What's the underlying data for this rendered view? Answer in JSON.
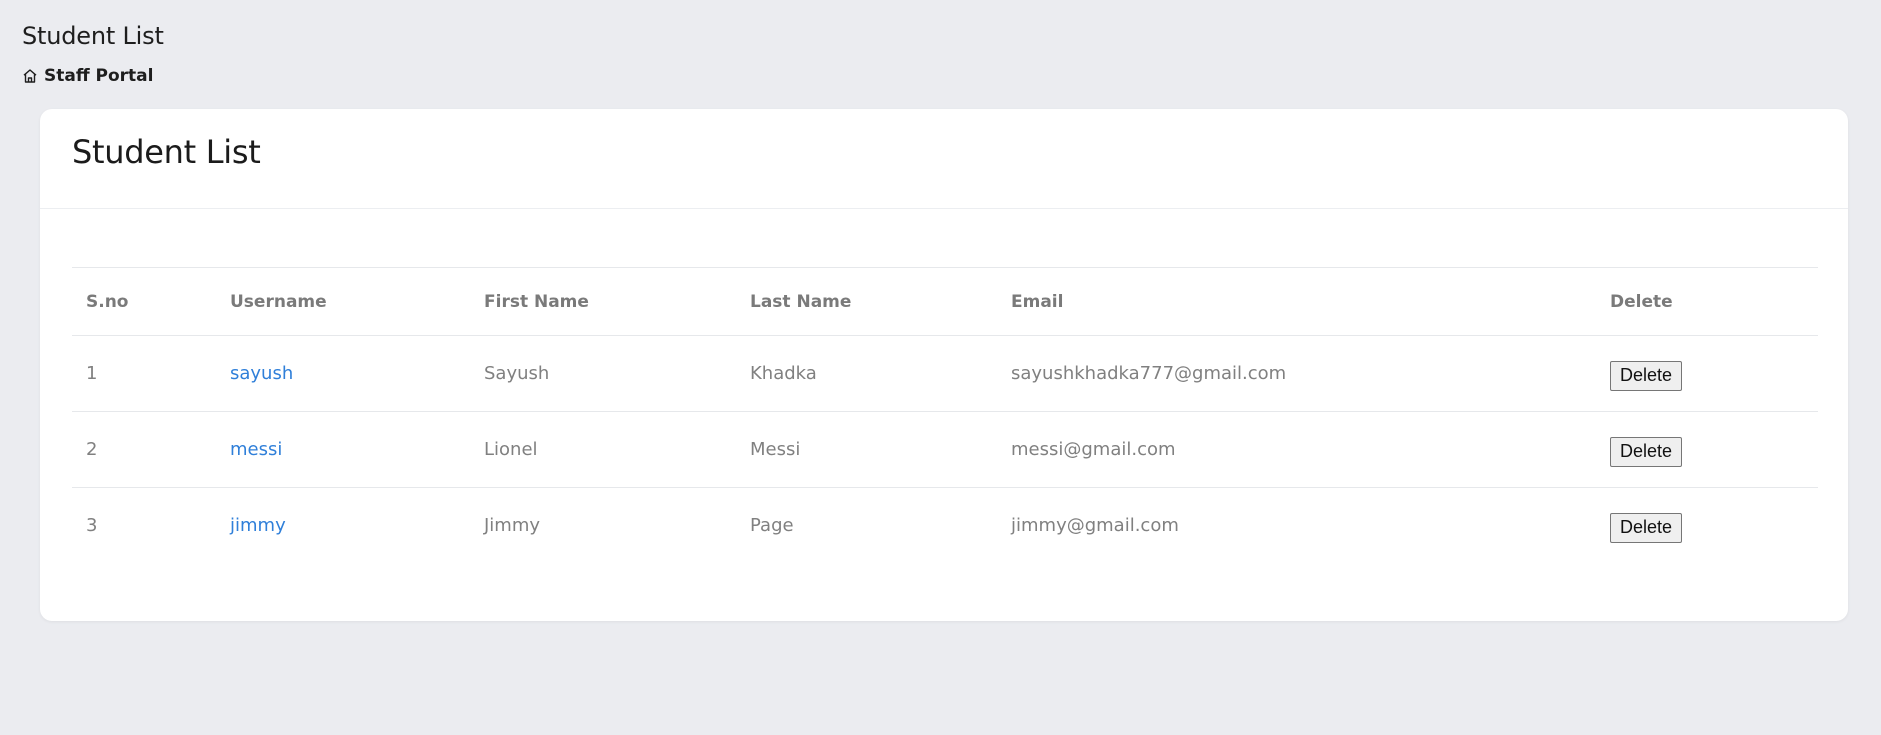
{
  "page": {
    "title": "Student List"
  },
  "breadcrumb": {
    "icon": "home-icon",
    "label": "Staff Portal"
  },
  "card": {
    "title": "Student List"
  },
  "table": {
    "headers": [
      "S.no",
      "Username",
      "First Name",
      "Last Name",
      "Email",
      "Delete"
    ],
    "rows": [
      {
        "sno": "1",
        "username": "sayush",
        "first_name": "Sayush",
        "last_name": "Khadka",
        "email": "sayushkhadka777@gmail.com",
        "delete_label": "Delete"
      },
      {
        "sno": "2",
        "username": "messi",
        "first_name": "Lionel",
        "last_name": "Messi",
        "email": "messi@gmail.com",
        "delete_label": "Delete"
      },
      {
        "sno": "3",
        "username": "jimmy",
        "first_name": "Jimmy",
        "last_name": "Page",
        "email": "jimmy@gmail.com",
        "delete_label": "Delete"
      }
    ]
  },
  "colors": {
    "background": "#ebecf0",
    "card": "#ffffff",
    "link": "#2f7fd9",
    "header_text": "#7a7a7a",
    "cell_text": "#808080"
  }
}
